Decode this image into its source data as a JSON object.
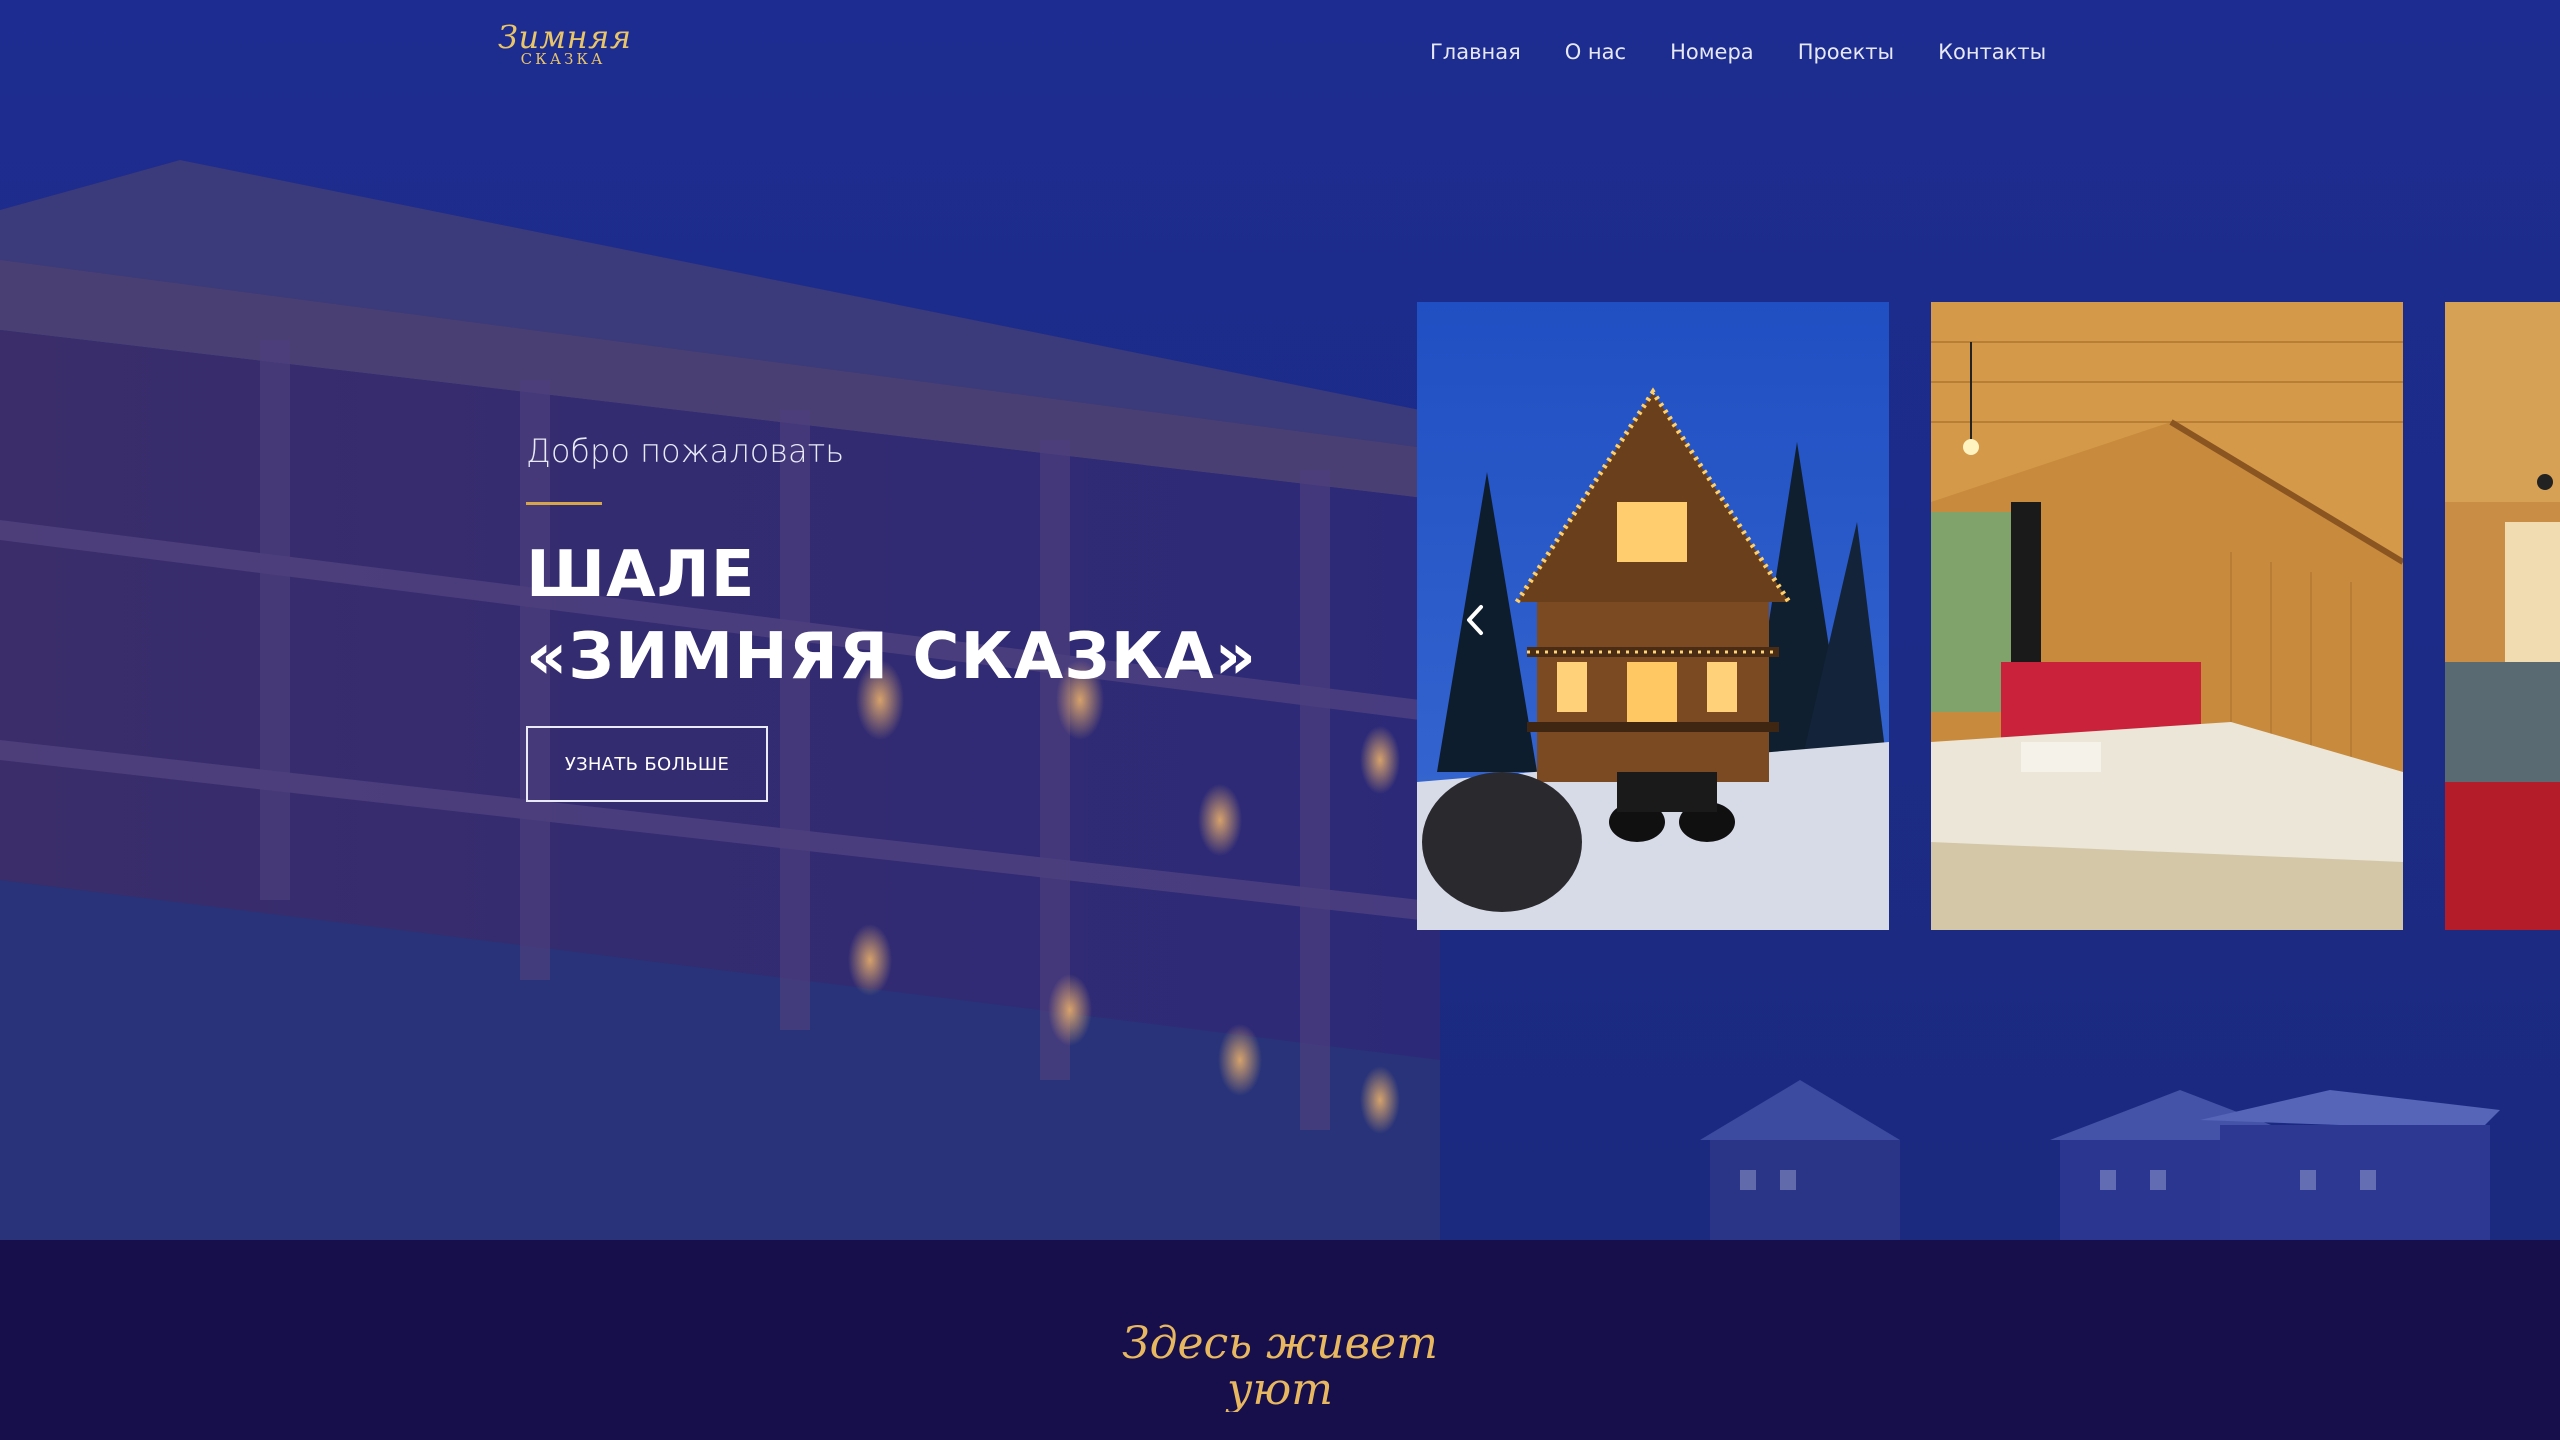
{
  "header": {
    "logo": {
      "script": "Зимняя",
      "caps": "СКАЗКА"
    },
    "nav": [
      {
        "label": "Главная"
      },
      {
        "label": "О нас"
      },
      {
        "label": "Номера"
      },
      {
        "label": "Проекты"
      },
      {
        "label": "Контакты"
      }
    ]
  },
  "hero": {
    "welcome": "Добро пожаловать",
    "title_line1": "ШАЛЕ",
    "title_line2": "«ЗИМНЯЯ СКАЗКА»",
    "cta_label": "УЗНАТЬ БОЛЬШЕ"
  },
  "slider": {
    "slides": [
      {
        "icon": "chalet-night-photo"
      },
      {
        "icon": "bedroom-photo"
      },
      {
        "icon": "living-room-photo"
      }
    ],
    "prev_icon": "chevron-left-icon"
  },
  "tagline": {
    "line1": "Здесь живет",
    "line2": "уют"
  },
  "colors": {
    "hero_overlay": "#1c2a8c",
    "band": "#160f4c",
    "accent_gold": "#d8a64a",
    "logo_gold": "#e9c56a",
    "text_light": "#e8eaf6"
  }
}
